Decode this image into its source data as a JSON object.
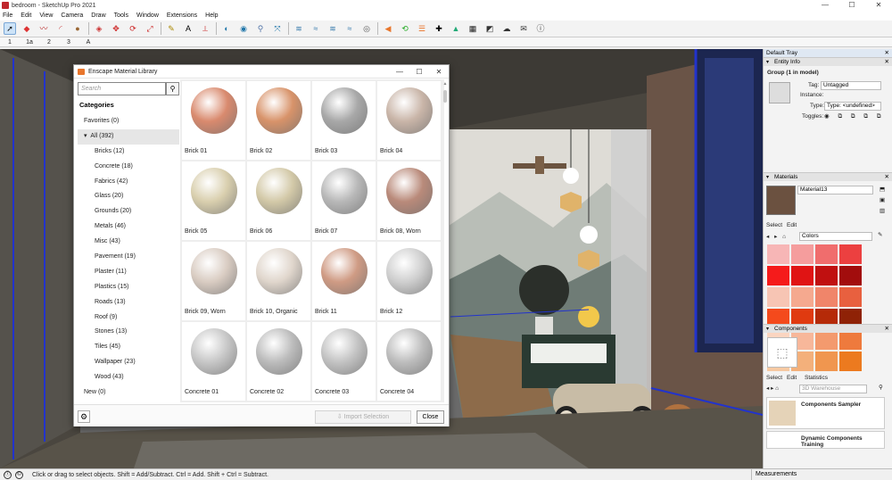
{
  "app": {
    "title": "bedroom - SketchUp Pro 2021"
  },
  "menu": [
    "File",
    "Edit",
    "View",
    "Camera",
    "Draw",
    "Tools",
    "Window",
    "Extensions",
    "Help"
  ],
  "window_buttons": [
    "—",
    "☐",
    "✕"
  ],
  "scenes": [
    "1",
    "1a",
    "2",
    "3",
    "A"
  ],
  "status": {
    "message": "Click or drag to select objects. Shift = Add/Subtract. Ctrl = Add. Shift + Ctrl = Subtract.",
    "measurements_label": "Measurements"
  },
  "dialog": {
    "title": "Enscape Material Library",
    "search_placeholder": "Search",
    "categories_heading": "Categories",
    "favorites": "Favorites (0)",
    "all": "All (392)",
    "subcategories": [
      "Bricks (12)",
      "Concrete (18)",
      "Fabrics (42)",
      "Glass (20)",
      "Grounds (20)",
      "Metals (46)",
      "Misc (43)",
      "Pavement (19)",
      "Plaster (11)",
      "Plastics (15)",
      "Roads (13)",
      "Roof (9)",
      "Stones (13)",
      "Tiles (45)",
      "Wallpaper (23)",
      "Wood (43)"
    ],
    "new": "New (0)",
    "materials": [
      "Brick 01",
      "Brick 02",
      "Brick 03",
      "Brick 04",
      "Brick 05",
      "Brick 06",
      "Brick 07",
      "Brick 08, Worn",
      "Brick 09, Worn",
      "Brick 10, Organic",
      "Brick 11",
      "Brick 12",
      "Concrete 01",
      "Concrete 02",
      "Concrete 03",
      "Concrete 04"
    ],
    "material_colors": [
      "#d98a6e",
      "#d8936a",
      "#a8a8a8",
      "#c9b5a8",
      "#d9cfae",
      "#d3c9a8",
      "#b8b8b8",
      "#b98a7a",
      "#d9ccc2",
      "#e0d6cc",
      "#cf9b84",
      "#cfcfcf",
      "#c7c7c7",
      "#bcbcbc",
      "#c3c3c3",
      "#bdbdbd"
    ],
    "import_label": "Import Selection",
    "close_label": "Close"
  },
  "tray": {
    "title": "Default Tray",
    "entity_info": {
      "header": "Entity Info",
      "group_label": "Group (1 in model)",
      "tag_label": "Tag:",
      "tag_value": "Untagged",
      "instance_label": "Instance:",
      "type_label": "Type:",
      "type_value": "Type: <undefined>",
      "toggles_label": "Toggles:"
    },
    "materials": {
      "header": "Materials",
      "material_name": "Material13",
      "select_tab": "Select",
      "edit_tab": "Edit",
      "library": "Colors",
      "swatches": [
        "#f7b6b6",
        "#f59d9d",
        "#f06d6d",
        "#ec4040",
        "#f51b1b",
        "#e01414",
        "#c01010",
        "#a20d0d",
        "#f7c5b4",
        "#f5a98f",
        "#f0856a",
        "#e8603f",
        "#f44a1c",
        "#e03a10",
        "#b52a08",
        "#8f2206",
        "#fbd5c0",
        "#f7b79a",
        "#f39a6e",
        "#ee7a3d",
        "#f6c9a2",
        "#f3b07b",
        "#f0964f",
        "#ec7a1f"
      ]
    },
    "components": {
      "header": "Components",
      "select_tab": "Select",
      "edit_tab": "Edit",
      "statistics_tab": "Statistics",
      "search_placeholder": "3D Warehouse",
      "item1": "Components Sampler",
      "item2": "Dynamic Components Training"
    }
  }
}
